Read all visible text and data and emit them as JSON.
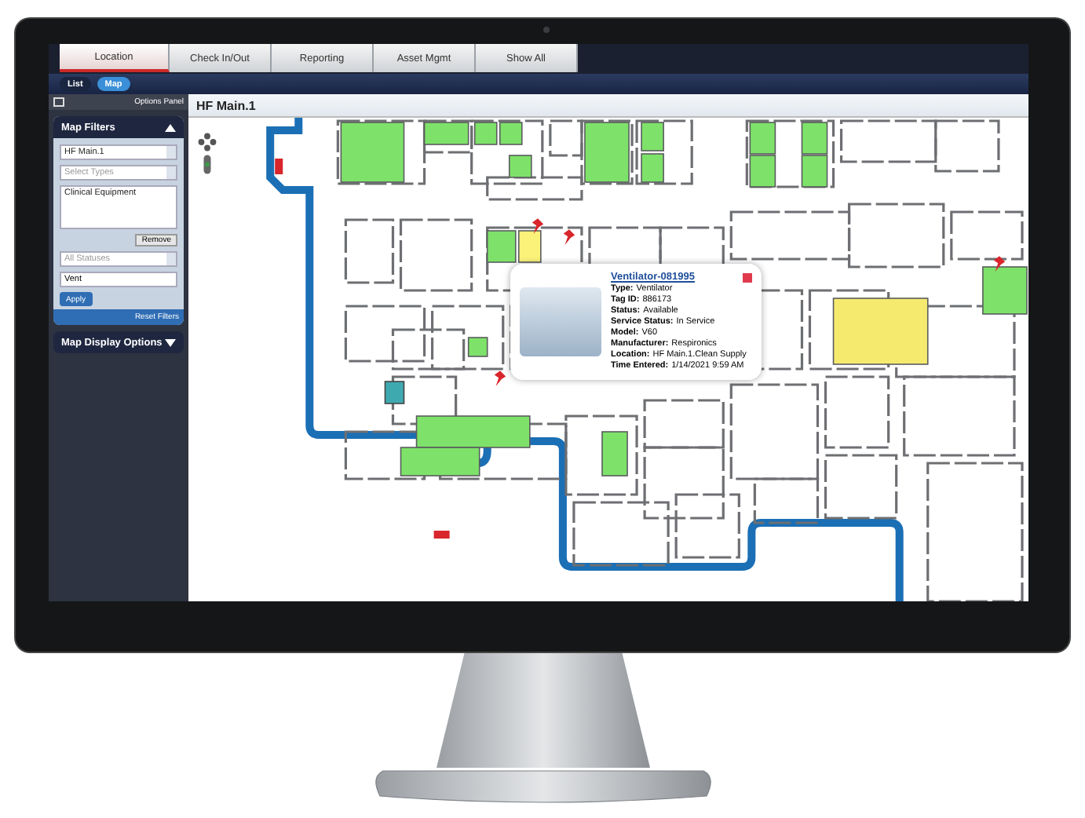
{
  "tabs": [
    {
      "label": "Location",
      "selected": true
    },
    {
      "label": "Check In/Out",
      "selected": false
    },
    {
      "label": "Reporting",
      "selected": false
    },
    {
      "label": "Asset Mgmt",
      "selected": false
    },
    {
      "label": "Show All",
      "selected": false
    }
  ],
  "view_toggle": [
    {
      "label": "List",
      "selected": false
    },
    {
      "label": "Map",
      "selected": true
    }
  ],
  "options_panel": {
    "title": "Options Panel",
    "map_filters": {
      "title": "Map Filters",
      "expanded": true,
      "floor": "HF Main.1",
      "types_placeholder": "Select Types",
      "selected_types": [
        "Clinical Equipment"
      ],
      "remove_button": "Remove",
      "status_placeholder": "All Statuses",
      "search_value": "Vent",
      "apply_button": "Apply",
      "reset_link": "Reset Filters"
    },
    "map_display_options": {
      "title": "Map Display Options",
      "expanded": false
    }
  },
  "map": {
    "title": "HF Main.1",
    "popup": {
      "title": "Ventilator-081995",
      "fields": [
        {
          "label": "Type:",
          "value": "Ventilator"
        },
        {
          "label": "Tag ID:",
          "value": "886173"
        },
        {
          "label": "Status:",
          "value": "Available"
        },
        {
          "label": "Service Status:",
          "value": "In Service"
        },
        {
          "label": "Model:",
          "value": "V60"
        },
        {
          "label": "Manufacturer:",
          "value": "Respironics"
        },
        {
          "label": "Location:",
          "value": "HF Main.1.Clean Supply"
        },
        {
          "label": "Time Entered:",
          "value": "1/14/2021 9:59 AM"
        }
      ]
    }
  }
}
